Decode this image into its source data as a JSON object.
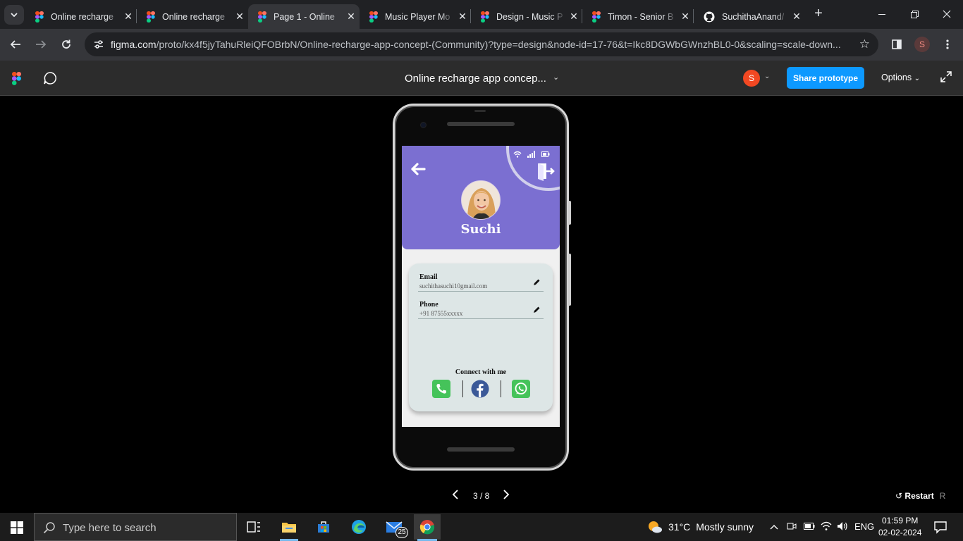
{
  "browser": {
    "tabs": [
      {
        "title": "Online recharge",
        "favicon": "figma-icon",
        "active": false
      },
      {
        "title": "Online recharge",
        "favicon": "figma-icon",
        "active": false
      },
      {
        "title": "Page 1 - Online",
        "favicon": "figma-icon",
        "active": true
      },
      {
        "title": "Music Player Mo",
        "favicon": "figma-icon",
        "active": false
      },
      {
        "title": "Design - Music P",
        "favicon": "figma-icon",
        "active": false
      },
      {
        "title": "Timon - Senior B",
        "favicon": "figma-icon",
        "active": false
      },
      {
        "title": "SuchithaAnand/",
        "favicon": "github-icon",
        "active": false
      }
    ],
    "close_glyph": "✕",
    "new_tab_glyph": "+",
    "url_host": "figma.com",
    "url_path": "/proto/kx4f5jyTahuRleiQFOBrbN/Online-recharge-app-concept-(Community)?type=design&node-id=17-76&t=Ikc8DGWbGWnzhBL0-0&scaling=scale-down...",
    "profile_initial": "S"
  },
  "figma": {
    "file_title": "Online recharge app concep...",
    "user_initial": "S",
    "share_label": "Share prototype",
    "options_label": "Options",
    "page_indicator": "3 / 8",
    "restart_label": "Restart",
    "restart_key": "R"
  },
  "app": {
    "user_name": "Suchi",
    "fields": [
      {
        "label": "Email",
        "value": "suchithasuchi10gmail.com"
      },
      {
        "label": "Phone",
        "value": "+91 87555xxxxx"
      }
    ],
    "connect_label": "Connect with me",
    "colors": {
      "header": "#7b6fd1",
      "card": "#dde6e6",
      "phone_green": "#45c35a",
      "facebook_blue": "#3b5998"
    }
  },
  "taskbar": {
    "search_placeholder": "Type here to search",
    "mail_badge": "25",
    "weather_temp": "31°C",
    "weather_text": "Mostly sunny",
    "lang": "ENG",
    "time": "01:59 PM",
    "date": "02-02-2024"
  }
}
